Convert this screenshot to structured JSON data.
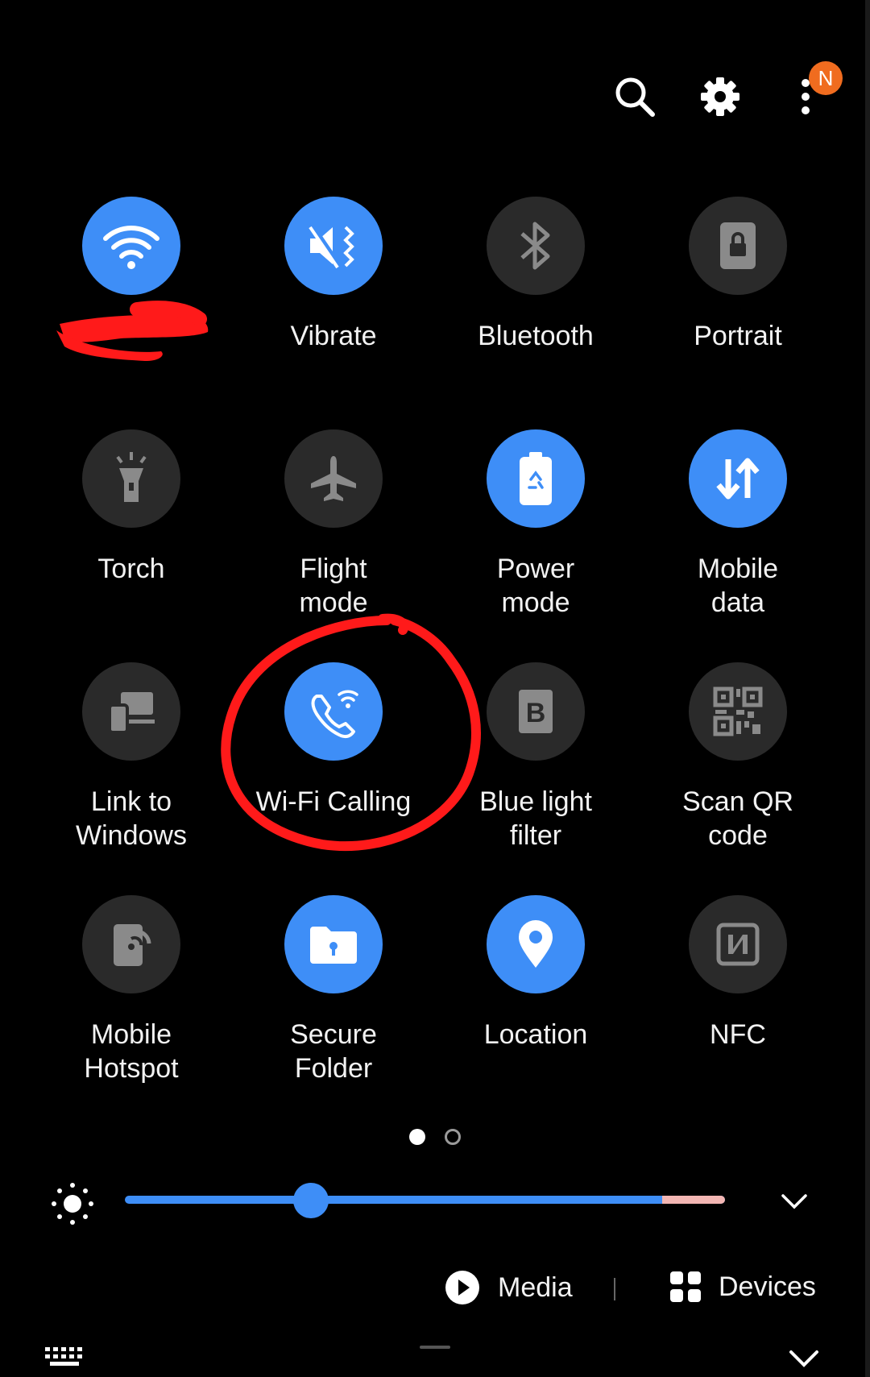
{
  "header": {
    "icons": [
      "search-icon",
      "gear-icon",
      "more-vertical-icon"
    ],
    "notification_badge": "N"
  },
  "tiles": [
    {
      "id": "wifi",
      "label": "",
      "icon": "wifi-icon",
      "state": "on"
    },
    {
      "id": "vibrate",
      "label": "Vibrate",
      "icon": "vibrate-icon",
      "state": "on"
    },
    {
      "id": "bluetooth",
      "label": "Bluetooth",
      "icon": "bluetooth-icon",
      "state": "off"
    },
    {
      "id": "portrait",
      "label": "Portrait",
      "icon": "rotation-lock-icon",
      "state": "off"
    },
    {
      "id": "torch",
      "label": "Torch",
      "icon": "torch-icon",
      "state": "off"
    },
    {
      "id": "flight",
      "label": "Flight\nmode",
      "icon": "airplane-icon",
      "state": "off"
    },
    {
      "id": "power",
      "label": "Power\nmode",
      "icon": "battery-icon",
      "state": "on"
    },
    {
      "id": "mobiledata",
      "label": "Mobile\ndata",
      "icon": "data-arrows-icon",
      "state": "on"
    },
    {
      "id": "linkwin",
      "label": "Link to\nWindows",
      "icon": "link-windows-icon",
      "state": "off"
    },
    {
      "id": "wificall",
      "label": "Wi-Fi Calling",
      "icon": "wifi-calling-icon",
      "state": "on"
    },
    {
      "id": "bluelight",
      "label": "Blue light\nfilter",
      "icon": "blue-light-icon",
      "state": "off"
    },
    {
      "id": "qr",
      "label": "Scan QR\ncode",
      "icon": "qr-code-icon",
      "state": "off"
    },
    {
      "id": "hotspot",
      "label": "Mobile\nHotspot",
      "icon": "hotspot-icon",
      "state": "off"
    },
    {
      "id": "securefolder",
      "label": "Secure\nFolder",
      "icon": "secure-folder-icon",
      "state": "on"
    },
    {
      "id": "location",
      "label": "Location",
      "icon": "location-pin-icon",
      "state": "on"
    },
    {
      "id": "nfc",
      "label": "NFC",
      "icon": "nfc-icon",
      "state": "off"
    }
  ],
  "pager": {
    "pages": 2,
    "current": 1
  },
  "brightness": {
    "level": 0.31,
    "icon": "sun-icon"
  },
  "media": {
    "label": "Media",
    "icon": "play-circle-icon"
  },
  "devices": {
    "label": "Devices",
    "icon": "devices-grid-icon"
  },
  "colors": {
    "accent": "#3e8ef7",
    "tile_off": "#2a2a2a",
    "badge": "#f06c1f",
    "annotation": "#ff1a1a"
  }
}
